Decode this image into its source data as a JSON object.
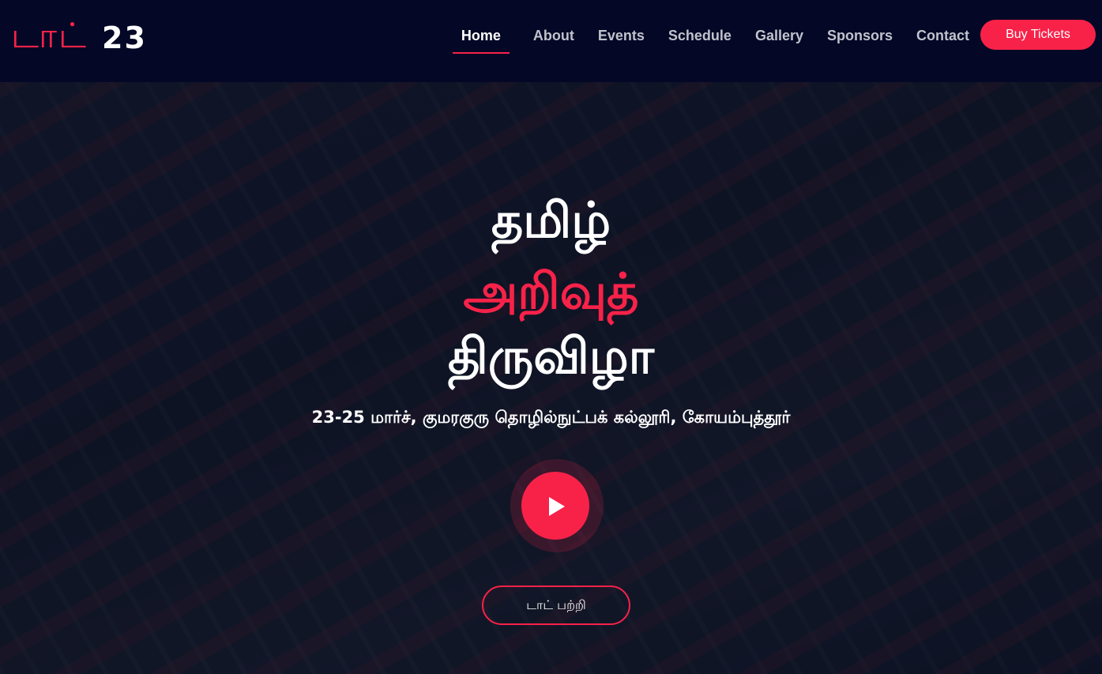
{
  "logo": {
    "tamil": "டாட்",
    "number": "23"
  },
  "nav": {
    "items": [
      {
        "label": "Home"
      },
      {
        "label": "About"
      },
      {
        "label": "Events"
      },
      {
        "label": "Schedule"
      },
      {
        "label": "Gallery"
      },
      {
        "label": "Sponsors"
      },
      {
        "label": "Contact"
      }
    ],
    "active": "Home",
    "cta_label": "Buy Tickets"
  },
  "hero": {
    "title_lines": [
      "தமிழ்",
      "அறிவுத்",
      "திருவிழா"
    ],
    "subtitle": "23-25 மார்ச், குமரகுரு தொழில்நுட்பக் கல்லூரி, கோயம்புத்தூர்",
    "play_icon": "play-icon",
    "about_button_label": "டாட் பற்றி"
  },
  "colors": {
    "accent": "#f82249",
    "header_bg": "#040826",
    "nav_text": "#c0c2cc",
    "text": "#ffffff"
  }
}
